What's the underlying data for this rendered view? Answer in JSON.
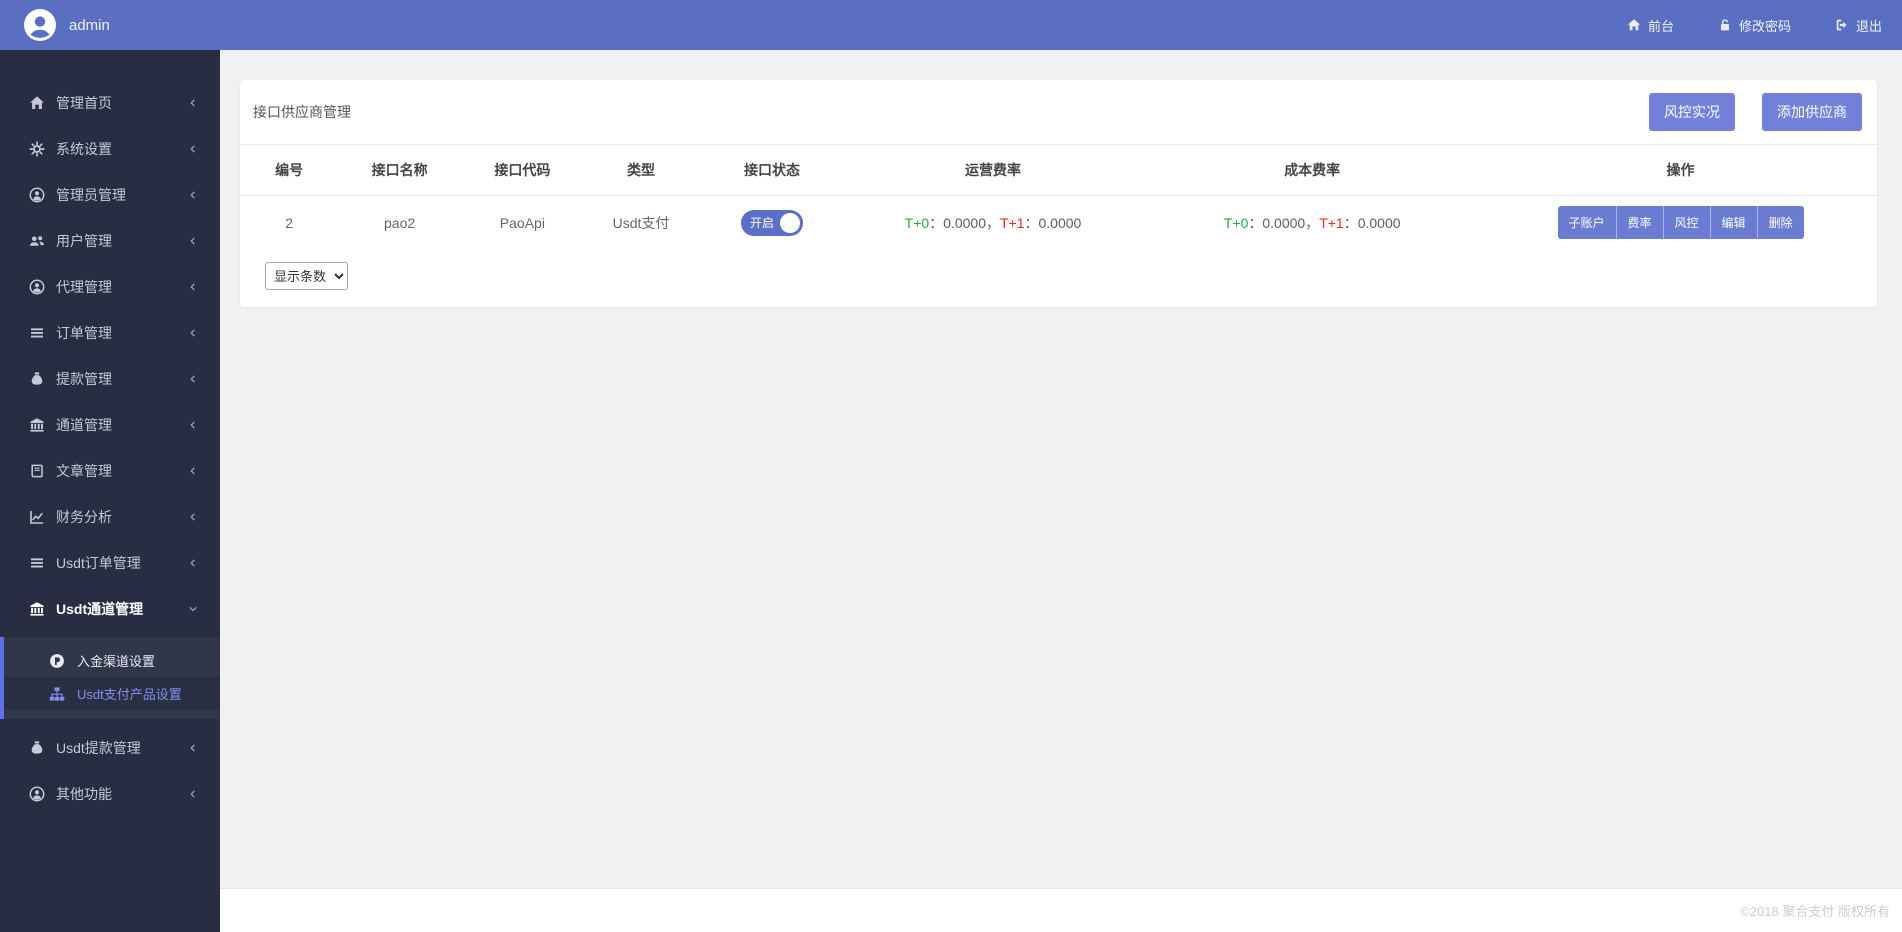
{
  "colors": {
    "topbar": "#5b6fc2",
    "sidebar": "#282d43",
    "submenu": "#30374b",
    "submenu_border": "#5f6fe8",
    "primary_button": "#7282da",
    "action_button": "#6b7cd3",
    "toggle_on": "#5a6fc8",
    "fee_green": "#28a745",
    "fee_red": "#f5222d",
    "content_bg": "#f1f1f3"
  },
  "topbar": {
    "username": "admin",
    "links": [
      {
        "key": "frontend",
        "label": "前台",
        "icon": "home"
      },
      {
        "key": "change-password",
        "label": "修改密码",
        "icon": "lock"
      },
      {
        "key": "logout",
        "label": "退出",
        "icon": "sign-out"
      }
    ]
  },
  "sidebar": {
    "items": [
      {
        "key": "manage-home",
        "label": "管理首页",
        "icon": "home",
        "chevron": "left"
      },
      {
        "key": "system-settings",
        "label": "系统设置",
        "icon": "gears",
        "chevron": "left"
      },
      {
        "key": "admin-manage",
        "label": "管理员管理",
        "icon": "user-circle",
        "chevron": "left"
      },
      {
        "key": "user-manage",
        "label": "用户管理",
        "icon": "users",
        "chevron": "left"
      },
      {
        "key": "agent-manage",
        "label": "代理管理",
        "icon": "user-circle",
        "chevron": "left"
      },
      {
        "key": "order-manage",
        "label": "订单管理",
        "icon": "list",
        "chevron": "left"
      },
      {
        "key": "withdraw-manage",
        "label": "提款管理",
        "icon": "money-bag",
        "chevron": "left"
      },
      {
        "key": "channel-manage",
        "label": "通道管理",
        "icon": "bank",
        "chevron": "left"
      },
      {
        "key": "article-manage",
        "label": "文章管理",
        "icon": "book",
        "chevron": "left"
      },
      {
        "key": "finance-analysis",
        "label": "财务分析",
        "icon": "chart-line",
        "chevron": "left"
      },
      {
        "key": "usdt-order-manage",
        "label": "Usdt订单管理",
        "icon": "list",
        "chevron": "left"
      },
      {
        "key": "usdt-channel-manage",
        "label": "Usdt通道管理",
        "icon": "bank",
        "chevron": "down",
        "active": true,
        "children": [
          {
            "key": "deposit-channel-settings",
            "label": "入金渠道设置",
            "icon": "p-circle"
          },
          {
            "key": "usdt-pay-product-settings",
            "label": "Usdt支付产品设置",
            "icon": "sitemap",
            "active": true
          }
        ]
      },
      {
        "key": "usdt-withdraw-manage",
        "label": "Usdt提款管理",
        "icon": "money-bag",
        "chevron": "left"
      },
      {
        "key": "other-functions",
        "label": "其他功能",
        "icon": "user-circle",
        "chevron": "left"
      }
    ]
  },
  "page": {
    "title": "接口供应商管理",
    "toolbar": [
      {
        "key": "risk-live",
        "label": "风控实况"
      },
      {
        "key": "add-supplier",
        "label": "添加供应商"
      }
    ],
    "table": {
      "headers": [
        "编号",
        "接口名称",
        "接口代码",
        "类型",
        "接口状态",
        "运营费率",
        "成本费率",
        "操作"
      ],
      "col_widths": [
        "6%",
        "7.5%",
        "7.5%",
        "7%",
        "9%",
        "18%",
        "21%",
        "24%"
      ],
      "rows": [
        {
          "id": "2",
          "name": "pao2",
          "code": "PaoApi",
          "type": "Usdt支付",
          "status": {
            "label": "开启",
            "on": true
          },
          "op_fee": {
            "t0_label": "T+0",
            "t0_value": "：0.0000，",
            "t1_label": "T+1",
            "t1_value": "：0.0000"
          },
          "cost_fee": {
            "t0_label": "T+0",
            "t0_value": "：0.0000，",
            "t1_label": "T+1",
            "t1_value": "：0.0000"
          },
          "actions": [
            {
              "key": "sub-account",
              "label": "子账户"
            },
            {
              "key": "rate",
              "label": "费率"
            },
            {
              "key": "risk",
              "label": "风控"
            },
            {
              "key": "edit",
              "label": "编辑"
            },
            {
              "key": "delete",
              "label": "删除"
            }
          ]
        }
      ]
    },
    "page_size": {
      "label": "显示条数"
    }
  },
  "footer": {
    "copyright": "©2018 聚合支付 版权所有"
  }
}
